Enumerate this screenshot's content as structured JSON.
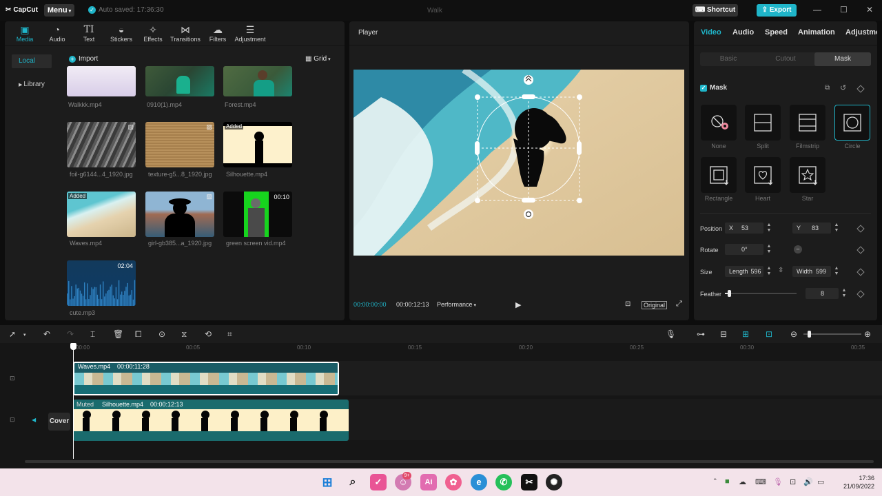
{
  "titlebar": {
    "app_name": "CapCut",
    "menu_label": "Menu",
    "autosave_text": "Auto saved: 17:36:30",
    "project_title": "Walk",
    "shortcut_label": "Shortcut",
    "export_label": "Export"
  },
  "media_tabs": [
    "Media",
    "Audio",
    "Text",
    "Stickers",
    "Effects",
    "Transitions",
    "Filters",
    "Adjustment"
  ],
  "media_side": {
    "local": "Local",
    "library": "Library"
  },
  "media_toolbar": {
    "import": "Import",
    "view": "Grid"
  },
  "media_items": [
    {
      "name": "Walkkk.mp4",
      "badge": "",
      "duration": ""
    },
    {
      "name": "0910(1).mp4",
      "badge": "",
      "duration": ""
    },
    {
      "name": "Forest.mp4",
      "badge": "",
      "duration": ""
    },
    {
      "name": "foil-g6144...4_1920.jpg",
      "badge": "",
      "duration": ""
    },
    {
      "name": "texture-g5...8_1920.jpg",
      "badge": "",
      "duration": ""
    },
    {
      "name": "Silhouette.mp4",
      "badge": "Added",
      "duration": ""
    },
    {
      "name": "Waves.mp4",
      "badge": "Added",
      "duration": ""
    },
    {
      "name": "girl-gb385...a_1920.jpg",
      "badge": "",
      "duration": ""
    },
    {
      "name": "green screen vid.mp4",
      "badge": "",
      "duration": "00:10"
    },
    {
      "name": "cute.mp3",
      "badge": "",
      "duration": "02:04"
    }
  ],
  "player": {
    "title": "Player",
    "current_time": "00:00:00:00",
    "total_time": "00:00:12:13",
    "performance": "Performance",
    "original": "Original"
  },
  "right_tabs": [
    "Video",
    "Audio",
    "Speed",
    "Animation",
    "Adjustme"
  ],
  "sub_tabs": [
    "Basic",
    "Cutout",
    "Mask"
  ],
  "mask": {
    "label": "Mask",
    "options": [
      "None",
      "Split",
      "Filmstrip",
      "Circle",
      "Rectangle",
      "Heart",
      "Star"
    ],
    "selected": "Circle"
  },
  "properties": {
    "position_label": "Position",
    "x_label": "X",
    "x_value": "53",
    "y_label": "Y",
    "y_value": "83",
    "rotate_label": "Rotate",
    "rotate_value": "0°",
    "size_label": "Size",
    "length_label": "Length",
    "length_value": "596",
    "width_label": "Width",
    "width_value": "599",
    "feather_label": "Feather",
    "feather_value": "8",
    "feather_level": 0.04
  },
  "timeline": {
    "ticks": [
      "00:00",
      "00:05",
      "00:10",
      "00:15",
      "00:20",
      "00:25",
      "00:30",
      "00:35"
    ],
    "clip1_name": "Waves.mp4",
    "clip1_duration": "00:00:11:28",
    "clip2_muted": "Muted",
    "clip2_name": "Silhouette.mp4",
    "clip2_duration": "00:00:12:13",
    "cover_label": "Cover"
  },
  "taskbar": {
    "time": "17:36",
    "date": "21/09/2022",
    "notification_badge": "9+"
  },
  "colors": {
    "accent": "#1fb5c9",
    "panel": "#1c1c1c",
    "background": "#0d0d0d",
    "taskbar": "#f3e3ea"
  }
}
